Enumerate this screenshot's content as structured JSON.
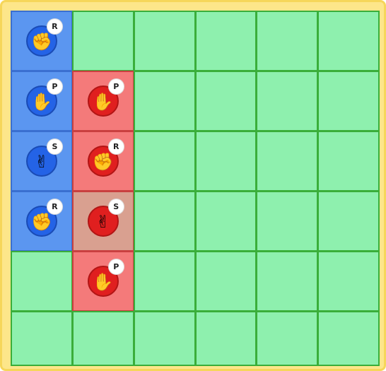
{
  "board": {
    "rows": 6,
    "cols": 6,
    "cells": [
      [
        {
          "t": "blue",
          "k": "R"
        },
        {
          "t": "empty"
        },
        {
          "t": "empty"
        },
        {
          "t": "empty"
        },
        {
          "t": "empty"
        },
        {
          "t": "empty"
        }
      ],
      [
        {
          "t": "blue",
          "k": "P"
        },
        {
          "t": "red",
          "k": "P"
        },
        {
          "t": "empty"
        },
        {
          "t": "empty"
        },
        {
          "t": "empty"
        },
        {
          "t": "empty"
        }
      ],
      [
        {
          "t": "blue",
          "k": "S"
        },
        {
          "t": "red",
          "k": "R"
        },
        {
          "t": "empty"
        },
        {
          "t": "empty"
        },
        {
          "t": "empty"
        },
        {
          "t": "empty"
        }
      ],
      [
        {
          "t": "blue",
          "k": "R"
        },
        {
          "t": "mix",
          "k": "S"
        },
        {
          "t": "empty"
        },
        {
          "t": "empty"
        },
        {
          "t": "empty"
        },
        {
          "t": "empty"
        }
      ],
      [
        {
          "t": "empty"
        },
        {
          "t": "red",
          "k": "P"
        },
        {
          "t": "empty"
        },
        {
          "t": "empty"
        },
        {
          "t": "empty"
        },
        {
          "t": "empty"
        }
      ],
      [
        {
          "t": "empty"
        },
        {
          "t": "empty"
        },
        {
          "t": "empty"
        },
        {
          "t": "empty"
        },
        {
          "t": "empty"
        },
        {
          "t": "empty"
        }
      ]
    ]
  },
  "pieces": {
    "R": {
      "label": "R",
      "glyph": "✊",
      "icon": "rock-fist-icon"
    },
    "P": {
      "label": "P",
      "glyph": "✋",
      "icon": "paper-hand-icon"
    },
    "S": {
      "label": "S",
      "glyph": "✌",
      "icon": "scissors-hand-icon"
    }
  },
  "colors": {
    "board_bg": "#fde68a",
    "empty_cell": "#8ef0ae",
    "blue_team": "#2463e6",
    "red_team": "#e01f1f"
  }
}
